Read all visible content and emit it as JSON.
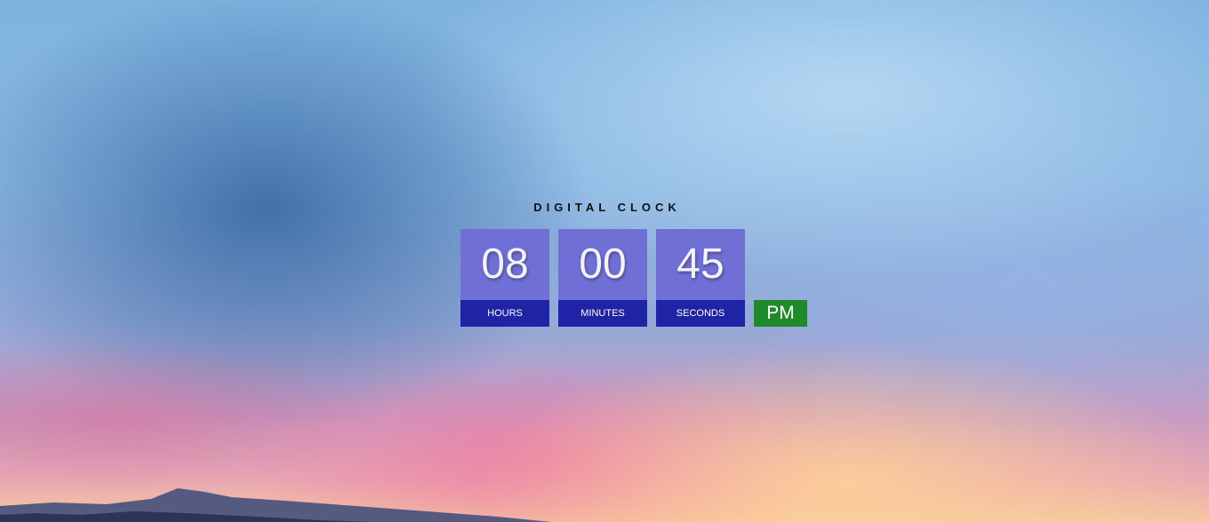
{
  "clock": {
    "title": "DIGITAL CLOCK",
    "hours": {
      "value": "08",
      "label": "HOURS"
    },
    "minutes": {
      "value": "00",
      "label": "MINUTES"
    },
    "seconds": {
      "value": "45",
      "label": "SECONDS"
    },
    "period": "PM"
  },
  "colors": {
    "digit_box": "#6f6fd6",
    "label_box": "#1f23a6",
    "period_box": "#1f8a2a"
  },
  "icons": {
    "background": "sunset-sky-image"
  }
}
